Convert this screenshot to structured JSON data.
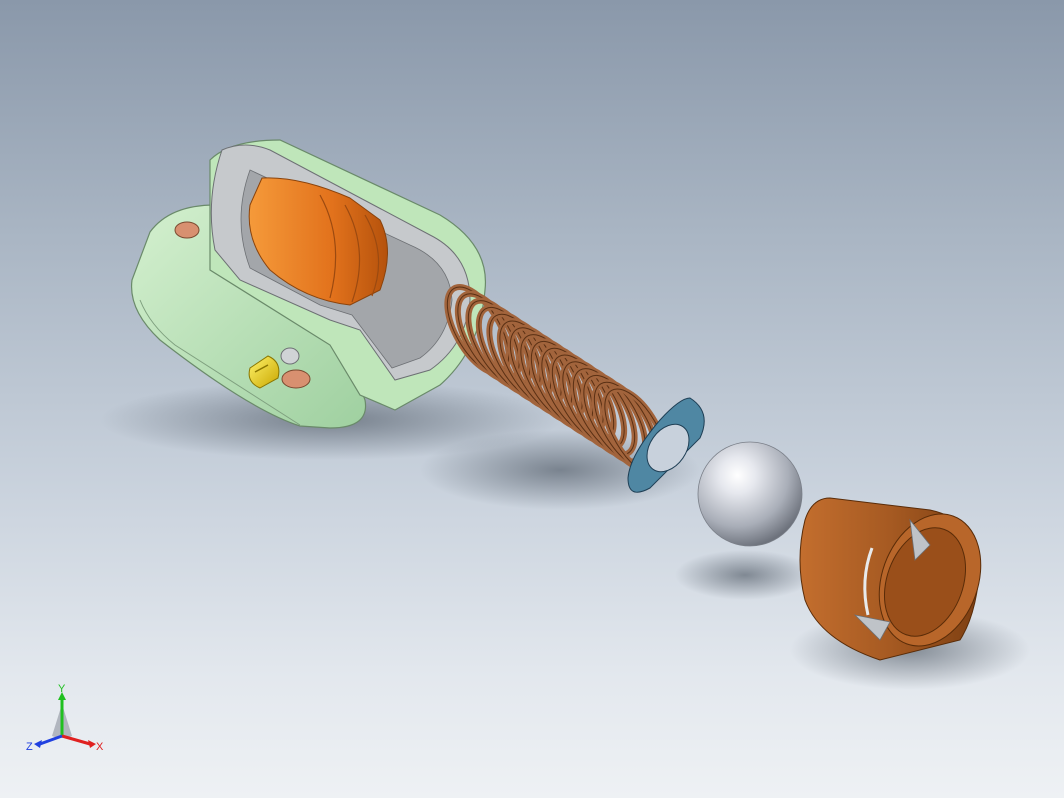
{
  "view": {
    "background_top": "#8a98aa",
    "background_bottom": "#eef1f4"
  },
  "model": {
    "parts": [
      {
        "name": "housing",
        "color": "#b9e3b6"
      },
      {
        "name": "inner-sleeve",
        "color": "#e2721c"
      },
      {
        "name": "set-screw",
        "color": "#e8d21a"
      },
      {
        "name": "spring",
        "color": "#a2643c"
      },
      {
        "name": "washer",
        "color": "#4f87a3"
      },
      {
        "name": "ball",
        "color": "#c9cdd4"
      },
      {
        "name": "cap",
        "color": "#a65a22"
      }
    ]
  },
  "triad": {
    "x_label": "X",
    "y_label": "Y",
    "z_label": "Z",
    "x_color": "#e02020",
    "y_color": "#20c020",
    "z_color": "#2040e0"
  }
}
